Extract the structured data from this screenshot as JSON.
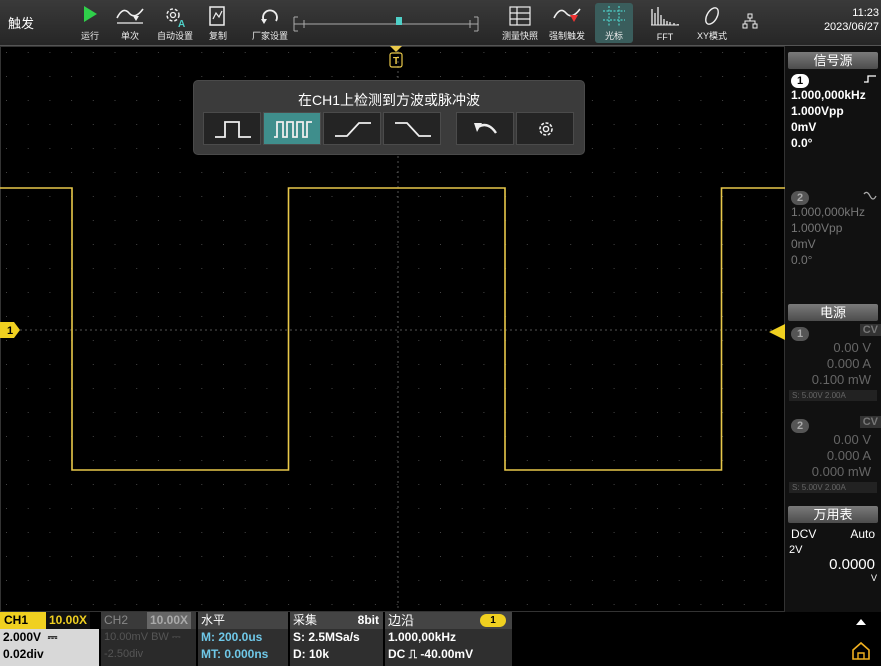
{
  "toolbar": {
    "trigger_label": "触发",
    "buttons": [
      {
        "icon": "play-icon",
        "label": "运行"
      },
      {
        "icon": "single-icon",
        "label": "单次"
      },
      {
        "icon": "auto-set-icon",
        "label": "自动设置"
      },
      {
        "icon": "copy-icon",
        "label": "复制"
      },
      {
        "icon": "factory-reset-icon",
        "label": "厂家设置"
      },
      {
        "icon": "measure-snapshot-icon",
        "label": "测量快照"
      },
      {
        "icon": "force-trigger-icon",
        "label": "强制触发"
      },
      {
        "icon": "cursor-icon",
        "label": "光标"
      },
      {
        "icon": "fft-icon",
        "label": "FFT"
      },
      {
        "icon": "xy-mode-icon",
        "label": "XY模式"
      },
      {
        "icon": "network-icon",
        "label": ""
      }
    ],
    "time": "11:23",
    "date": "2023/06/27"
  },
  "popup": {
    "title": "在CH1上检测到方波或脉冲波",
    "options": [
      {
        "icon": "single-pulse-icon",
        "selected": false
      },
      {
        "icon": "pulse-train-icon",
        "selected": true
      },
      {
        "icon": "rising-edge-icon",
        "selected": false
      },
      {
        "icon": "falling-edge-icon",
        "selected": false
      },
      {
        "icon": "undo-icon",
        "selected": false
      },
      {
        "icon": "settings-icon",
        "selected": false
      }
    ]
  },
  "markers": {
    "trigger_pos_label": "T",
    "ch1_label": "1"
  },
  "waveform": {
    "channel": "CH1",
    "color": "#e8c84a",
    "frequency": "1.000,000kHz",
    "amplitude": "1.000Vpp",
    "duty_cycle_percent": 50
  },
  "right_panel": {
    "signal_source": {
      "title": "信号源",
      "ch1": {
        "num": "1",
        "freq": "1.000,000kHz",
        "amp": "1.000Vpp",
        "offset": "0mV",
        "phase": "0.0°"
      },
      "ch2": {
        "num": "2",
        "freq": "1.000,000kHz",
        "amp": "1.000Vpp",
        "offset": "0mV",
        "phase": "0.0°"
      }
    },
    "power": {
      "title": "电源",
      "ch1": {
        "num": "1",
        "mode": "CV",
        "volt": "0.00 V",
        "curr": "0.000 A",
        "pow": "0.100 mW",
        "set": "S: 5.00V 2.00A"
      },
      "ch2": {
        "num": "2",
        "mode": "CV",
        "volt": "0.00 V",
        "curr": "0.000 A",
        "pow": "0.000 mW",
        "set": "S: 5.00V 2.00A"
      }
    },
    "multimeter": {
      "title": "万用表",
      "mode": "DCV",
      "range": "Auto",
      "scale": "2V",
      "reading": "0.0000",
      "unit": "V"
    }
  },
  "status": {
    "ch1": {
      "name": "CH1",
      "probe": "10.00X",
      "scale": "2.000V",
      "coupling": "⎓",
      "offset": "0.02div"
    },
    "ch2": {
      "name": "CH2",
      "probe": "10.00X",
      "scale": "10.00mV BW",
      "coupling": "⎓",
      "offset": "-2.50div"
    },
    "horizontal": {
      "title": "水平",
      "main": "M: 200.0us",
      "mt": "MT: 0.000ns"
    },
    "acquire": {
      "title": "采集",
      "bits": "8bit",
      "rate": "S: 2.5MSa/s",
      "depth": "D: 10k"
    },
    "trigger": {
      "title": "边沿",
      "source": "1",
      "freq": "1.000,00kHz",
      "level": "DC ⎍ -40.00mV"
    }
  },
  "colors": {
    "ch1": "#e8c84a",
    "accent": "#3f8e8c",
    "trigger_badge": "#f0d020"
  }
}
